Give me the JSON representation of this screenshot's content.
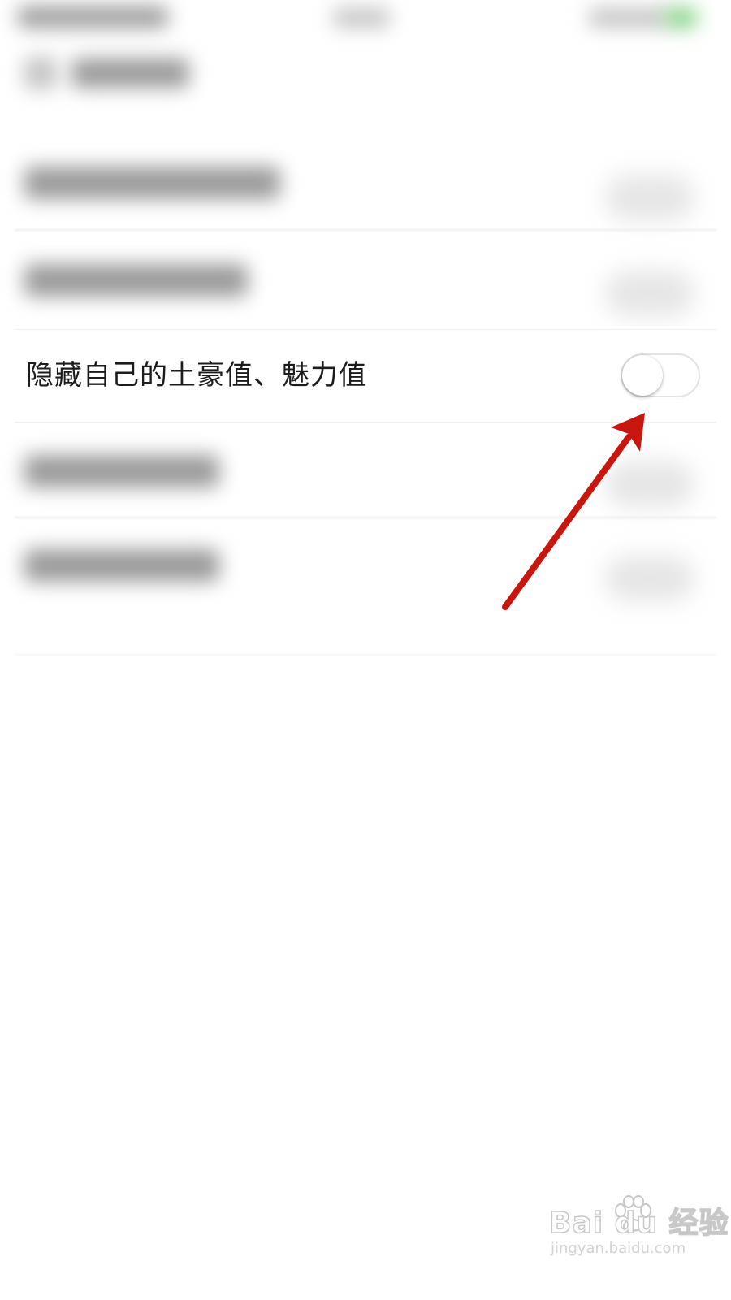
{
  "setting": {
    "label": "隐藏自己的土豪值、魅力值",
    "enabled": false
  },
  "colors": {
    "annotation_arrow": "#c8170f",
    "toggle_border": "#e3e3e3",
    "text": "#1c1c1c"
  },
  "watermark": {
    "logo": "Bai  du 经验",
    "url": "jingyan.baidu.com"
  },
  "icons": {
    "annotation": "arrow-icon",
    "watermark": "baidu-paw-icon"
  }
}
